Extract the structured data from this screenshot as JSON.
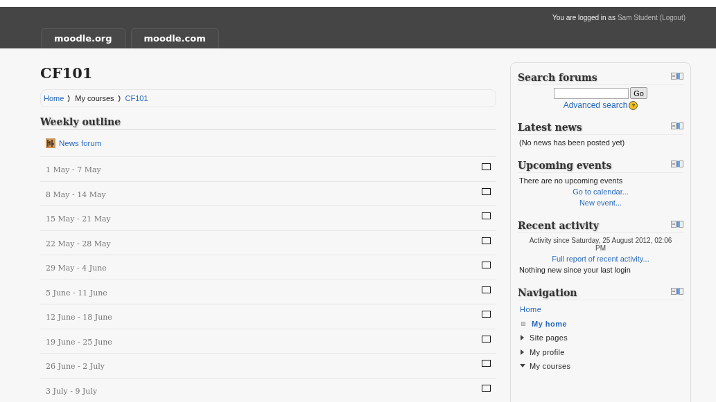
{
  "header": {
    "login_prefix": "You are logged in as",
    "user": "Sam Student",
    "logout": "(Logout)",
    "tabs": [
      {
        "label": "moodle.org"
      },
      {
        "label": "moodle.com"
      }
    ]
  },
  "course": {
    "title": "CF101",
    "breadcrumb": [
      {
        "label": "Home",
        "kind": "link"
      },
      {
        "label": "My courses",
        "kind": "text"
      },
      {
        "label": "CF101",
        "kind": "link"
      }
    ]
  },
  "outline": {
    "heading": "Weekly outline",
    "forum": "News forum",
    "weeks": [
      "1 May - 7 May",
      "8 May - 14 May",
      "15 May - 21 May",
      "22 May - 28 May",
      "29 May - 4 June",
      "5 June - 11 June",
      "12 June - 18 June",
      "19 June - 25 June",
      "26 June - 2 July",
      "3 July - 9 July"
    ]
  },
  "blocks": [
    {
      "kind": "search",
      "title": "Search forums",
      "button": "Go",
      "link": "Advanced search",
      "help": "?"
    },
    {
      "kind": "text",
      "title": "Latest news",
      "lines": [
        {
          "text": "(No news has been posted yet)",
          "kind": "plain"
        }
      ]
    },
    {
      "kind": "text",
      "title": "Upcoming events",
      "lines": [
        {
          "text": "There are no upcoming events",
          "kind": "plain"
        },
        {
          "text": "Go to calendar...",
          "kind": "link"
        },
        {
          "text": "New event...",
          "kind": "link"
        }
      ]
    },
    {
      "kind": "text",
      "title": "Recent activity",
      "lines": [
        {
          "text": "Activity since Saturday, 25 August 2012, 02:06 PM",
          "kind": "note"
        },
        {
          "text": "Full report of recent activity...",
          "kind": "link"
        },
        {
          "text": "Nothing new since your last login",
          "kind": "plain"
        }
      ]
    },
    {
      "kind": "nav",
      "title": "Navigation",
      "items": [
        {
          "label": "Home",
          "kind": "link"
        },
        {
          "label": "My home",
          "kind": "leaf"
        },
        {
          "label": "Site pages",
          "kind": "branch",
          "expanded": false
        },
        {
          "label": "My profile",
          "kind": "branch",
          "expanded": false
        },
        {
          "label": "My courses",
          "kind": "branch",
          "expanded": true
        }
      ]
    }
  ]
}
